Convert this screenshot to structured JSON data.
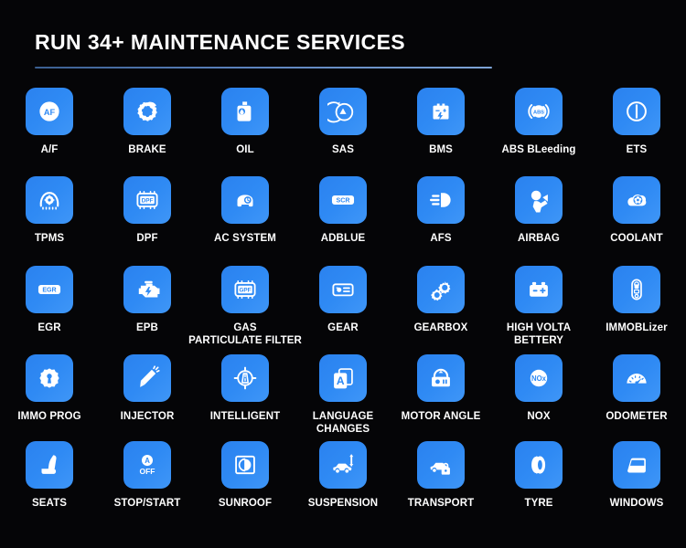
{
  "header": {
    "title": "RUN 34+ MAINTENANCE SERVICES"
  },
  "grid": {
    "columns": 7,
    "accent_color": "#2f8af4",
    "background_color": "#050507",
    "label_color": "#ffffff",
    "rule_color": "#5b82bd",
    "items": [
      {
        "label": "A/F",
        "icon": "af-badge-icon",
        "badge": "AF"
      },
      {
        "label": "BRAKE",
        "icon": "brake-disc-icon",
        "badge": ""
      },
      {
        "label": "OIL",
        "icon": "oil-can-icon",
        "badge": ""
      },
      {
        "label": "SAS",
        "icon": "steering-angle-icon",
        "badge": ""
      },
      {
        "label": "BMS",
        "icon": "battery-icon",
        "badge": ""
      },
      {
        "label": "ABS  BLeeding",
        "icon": "abs-icon",
        "badge": "ABS"
      },
      {
        "label": "ETS",
        "icon": "ets-icon",
        "badge": ""
      },
      {
        "label": "TPMS",
        "icon": "tyre-pressure-icon",
        "badge": ""
      },
      {
        "label": "DPF",
        "icon": "dpf-icon",
        "badge": "DPF"
      },
      {
        "label": "AC  SYSTEM",
        "icon": "ac-system-icon",
        "badge": ""
      },
      {
        "label": "ADBLUE",
        "icon": "scr-icon",
        "badge": "SCR"
      },
      {
        "label": "AFS",
        "icon": "headlight-icon",
        "badge": ""
      },
      {
        "label": "AIRBAG",
        "icon": "airbag-icon",
        "badge": ""
      },
      {
        "label": "COOLANT",
        "icon": "coolant-fan-icon",
        "badge": ""
      },
      {
        "label": "EGR",
        "icon": "egr-icon",
        "badge": "EGR"
      },
      {
        "label": "EPB",
        "icon": "engine-icon",
        "badge": ""
      },
      {
        "label": "GAS\nPARTICULATE FILTER",
        "icon": "gpf-icon",
        "badge": "GPF"
      },
      {
        "label": "GEAR",
        "icon": "gear-module-icon",
        "badge": ""
      },
      {
        "label": "GEARBOX",
        "icon": "gears-icon",
        "badge": ""
      },
      {
        "label": "HIGH VOLTA\nBETTERY",
        "icon": "hv-battery-icon",
        "badge": ""
      },
      {
        "label": "IMMOBLizer",
        "icon": "key-fob-icon",
        "badge": ""
      },
      {
        "label": "IMMO PROG",
        "icon": "immo-prog-icon",
        "badge": ""
      },
      {
        "label": "INJECTOR",
        "icon": "injector-icon",
        "badge": ""
      },
      {
        "label": "INTELLIGENT",
        "icon": "crosshair-road-icon",
        "badge": ""
      },
      {
        "label": "LANGUAGE\nCHANGES",
        "icon": "language-card-icon",
        "badge": "A"
      },
      {
        "label": "MOTOR ANGLE",
        "icon": "motor-angle-icon",
        "badge": ""
      },
      {
        "label": "NOX",
        "icon": "nox-icon",
        "badge": "NOx"
      },
      {
        "label": "ODOMETER",
        "icon": "odometer-icon",
        "badge": ""
      },
      {
        "label": "SEATS",
        "icon": "car-seat-icon",
        "badge": ""
      },
      {
        "label": "STOP/START",
        "icon": "auto-stop-icon",
        "badge": "OFF"
      },
      {
        "label": "SUNROOF",
        "icon": "sunroof-icon",
        "badge": ""
      },
      {
        "label": "SUSPENSION",
        "icon": "suspension-icon",
        "badge": ""
      },
      {
        "label": "TRANSPORT",
        "icon": "transport-lock-icon",
        "badge": ""
      },
      {
        "label": "TYRE",
        "icon": "tyre-icon",
        "badge": ""
      },
      {
        "label": "WINDOWS",
        "icon": "window-icon",
        "badge": ""
      }
    ]
  }
}
